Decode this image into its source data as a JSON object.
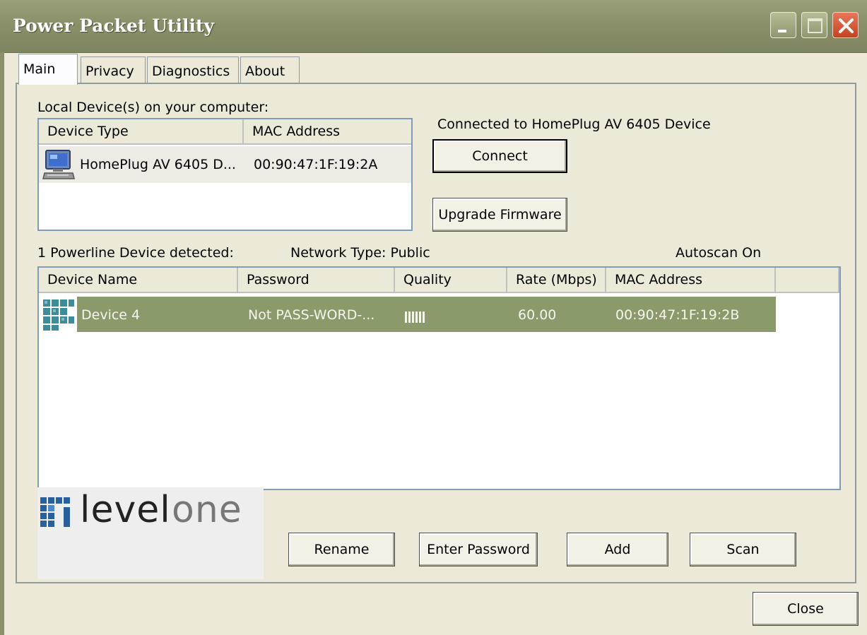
{
  "window": {
    "title": "Power Packet Utility"
  },
  "tabs": [
    {
      "label": "Main",
      "active": true
    },
    {
      "label": "Privacy",
      "active": false
    },
    {
      "label": "Diagnostics",
      "active": false
    },
    {
      "label": "About",
      "active": false
    }
  ],
  "local": {
    "heading": "Local Device(s) on your computer:",
    "columns": [
      "Device Type",
      "MAC Address"
    ],
    "rows": [
      {
        "device_type": "HomePlug AV 6405 D...",
        "mac": "00:90:47:1F:19:2A",
        "icon": "computer-icon"
      }
    ],
    "connected_text": "Connected to HomePlug AV 6405 Device",
    "connect_label": "Connect",
    "upgrade_label": "Upgrade Firmware"
  },
  "powerline": {
    "detected_text": "1 Powerline Device detected:",
    "network_type_text": "Network Type: Public",
    "autoscan_text": "Autoscan On",
    "columns": [
      "Device Name",
      "Password",
      "Quality",
      "Rate (Mbps)",
      "MAC Address"
    ],
    "rows": [
      {
        "name": "Device 4",
        "password": "Not PASS-WORD-...",
        "quality_bars": 6,
        "rate": "60.00",
        "mac": "00:90:47:1F:19:2B",
        "icon": "powerline-device-icon",
        "selected": true
      }
    ]
  },
  "logo": {
    "text_left": "level",
    "text_right": "one",
    "icon": "levelone-logo-icon"
  },
  "actions": {
    "rename_label": "Rename",
    "enter_password_label": "Enter Password",
    "add_label": "Add",
    "scan_label": "Scan"
  },
  "footer": {
    "close_label": "Close"
  },
  "colors": {
    "titlebar": "#8a9068",
    "selected_row": "#8a9a6a",
    "close_button": "#c24421",
    "logo_blue": "#2a5f9e"
  }
}
